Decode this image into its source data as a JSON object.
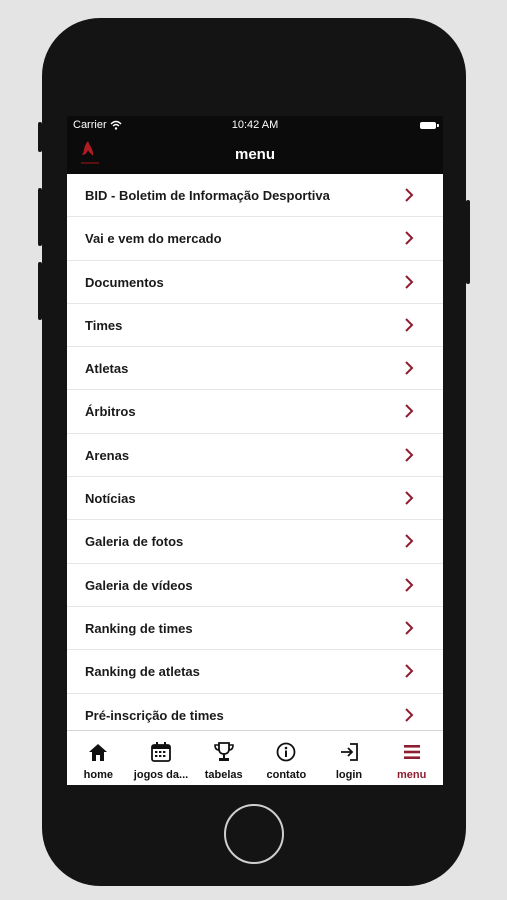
{
  "status_bar": {
    "carrier": "Carrier",
    "time": "10:42 AM"
  },
  "nav": {
    "title": "menu"
  },
  "colors": {
    "accent": "#8f1d31",
    "bar_bg": "#0b0b0b"
  },
  "menu_items": [
    "BID - Boletim de Informação Desportiva",
    "Vai e vem do mercado",
    "Documentos",
    "Times",
    "Atletas",
    "Árbitros",
    "Arenas",
    "Notícias",
    "Galeria de fotos",
    "Galeria de vídeos",
    "Ranking de times",
    "Ranking de atletas",
    "Pré-inscrição de times"
  ],
  "tabs": [
    {
      "label": "home",
      "icon": "home-icon"
    },
    {
      "label": "jogos da...",
      "icon": "calendar-icon"
    },
    {
      "label": "tabelas",
      "icon": "trophy-icon"
    },
    {
      "label": "contato",
      "icon": "info-icon"
    },
    {
      "label": "login",
      "icon": "login-icon"
    },
    {
      "label": "menu",
      "icon": "menu-icon",
      "active": true
    }
  ]
}
